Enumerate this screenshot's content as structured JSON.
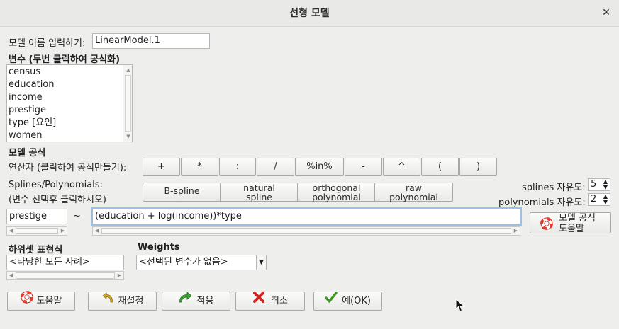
{
  "window": {
    "title": "선형 모델",
    "close_glyph": "✕"
  },
  "model_name": {
    "label": "모델 이름 입력하기:",
    "value": "LinearModel.1"
  },
  "variables": {
    "label": "변수 (두번 클릭하여 공식화)",
    "items": [
      "census",
      "education",
      "income",
      "prestige",
      "type [요인]",
      "women"
    ]
  },
  "formula": {
    "section_label": "모델 공식",
    "operators_label": "연산자 (클릭하여 공식만들기):",
    "operators": [
      "+",
      "*",
      ":",
      "/",
      "%in%",
      "-",
      "^",
      "(",
      ")"
    ],
    "splines_label_1": "Splines/Polynomials:",
    "splines_label_2": "(변수 선택후 클릭하시오)",
    "spline_buttons": [
      {
        "line1": "B-spline",
        "line2": ""
      },
      {
        "line1": "natural",
        "line2": "spline"
      },
      {
        "line1": "orthogonal",
        "line2": "polynomial"
      },
      {
        "line1": "raw",
        "line2": "polynomial"
      }
    ],
    "splines_df_label": "splines 자유도:",
    "splines_df_value": "5",
    "poly_df_label": "polynomials 자유도:",
    "poly_df_value": "2",
    "lhs_value": "prestige",
    "tilde": "~",
    "rhs_value": "(education + log(income))*type",
    "help_button_line1": "모델 공식",
    "help_button_line2": "도움말"
  },
  "subset": {
    "label": "하위셋 표현식",
    "value": "<타당한 모든 사례>"
  },
  "weights": {
    "label": "Weights",
    "selected": "<선택된 변수가 없음>"
  },
  "actions": {
    "help": "도움말",
    "reset": "재설정",
    "apply": "적용",
    "cancel": "취소",
    "ok": "예(OK)"
  },
  "icons": {
    "help": "lifebuoy-icon",
    "reset": "undo-arrow-icon",
    "apply": "redo-arrow-icon",
    "cancel": "red-x-icon",
    "ok": "green-check-icon"
  },
  "colors": {
    "focus_outline": "#9bbfe6",
    "cancel_red": "#d42020",
    "ok_green": "#3a9a1e",
    "arrow_gold": "#c89a14",
    "apply_green": "#3a9a2e"
  }
}
